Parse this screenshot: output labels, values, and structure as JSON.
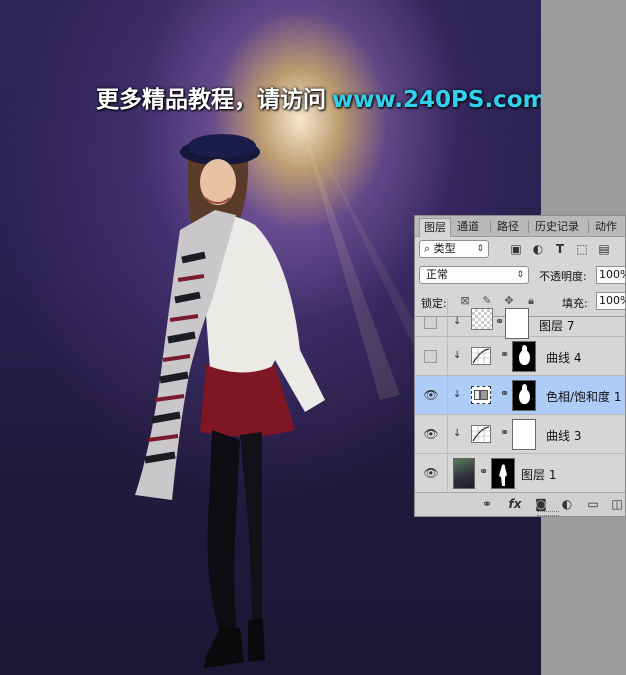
{
  "watermark": {
    "text_cn": "更多精品教程，请访问",
    "text_url": "www.240PS.com"
  },
  "panel": {
    "tabs": [
      "图层",
      "通道",
      "路径",
      "历史记录",
      "动作"
    ],
    "kind_filter": {
      "icon": "search-icon",
      "label": "类型"
    },
    "filter_icons": [
      "image-filter-icon",
      "adjustment-filter-icon",
      "type-filter-icon",
      "shape-filter-icon",
      "smart-object-filter-icon"
    ],
    "blend_mode": "正常",
    "opacity_label": "不透明度:",
    "opacity_value": "100%",
    "lock_label": "锁定:",
    "fill_label": "填充:",
    "fill_value": "100%",
    "layers": [
      {
        "name": "图层 7",
        "visible": false,
        "kind": "pixel",
        "clipped": true,
        "selected": false
      },
      {
        "name": "曲线 4",
        "visible": false,
        "kind": "curves",
        "clipped": true,
        "mask": "drop",
        "selected": false
      },
      {
        "name": "色相/饱和度 1",
        "visible": true,
        "kind": "hue-saturation",
        "clipped": true,
        "mask": "drop",
        "selected": true
      },
      {
        "name": "曲线 3",
        "visible": true,
        "kind": "curves",
        "clipped": true,
        "mask": "white",
        "selected": false
      },
      {
        "name": "图层 1",
        "visible": true,
        "kind": "photo",
        "clipped": false,
        "mask": "figure",
        "selected": false
      }
    ],
    "bottom_icons": [
      "link-layers-icon",
      "fx-icon",
      "add-mask-icon",
      "adjustment-icon",
      "new-group-icon",
      "new-layer-icon"
    ],
    "fx_label": "fx"
  }
}
